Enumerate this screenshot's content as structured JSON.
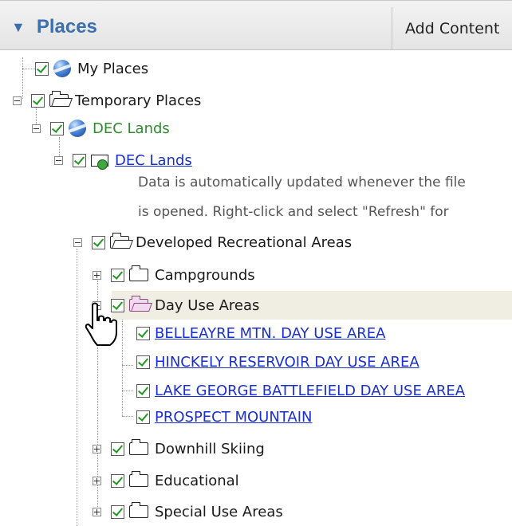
{
  "header": {
    "title": "Places",
    "add_content": "Add Content"
  },
  "tree": {
    "my_places": "My Places",
    "temporary_places": "Temporary Places",
    "dec_lands_kml": "DEC Lands",
    "dec_lands_link": "DEC Lands",
    "description_line1": "Data is automatically updated whenever the file",
    "description_line2": "is opened. Right-click and select \"Refresh\" for",
    "developed_areas": "Developed Recreational Areas",
    "campgrounds": "Campgrounds",
    "day_use_areas": "Day Use Areas",
    "day_use_items": [
      "BELLEAYRE MTN. DAY USE AREA",
      "HINCKELY RESERVOIR DAY USE AREA",
      "LAKE GEORGE BATTLEFIELD DAY USE AREA",
      "PROSPECT MOUNTAIN"
    ],
    "downhill_skiing": "Downhill Skiing",
    "educational": "Educational",
    "special_use_areas": "Special Use Areas"
  }
}
